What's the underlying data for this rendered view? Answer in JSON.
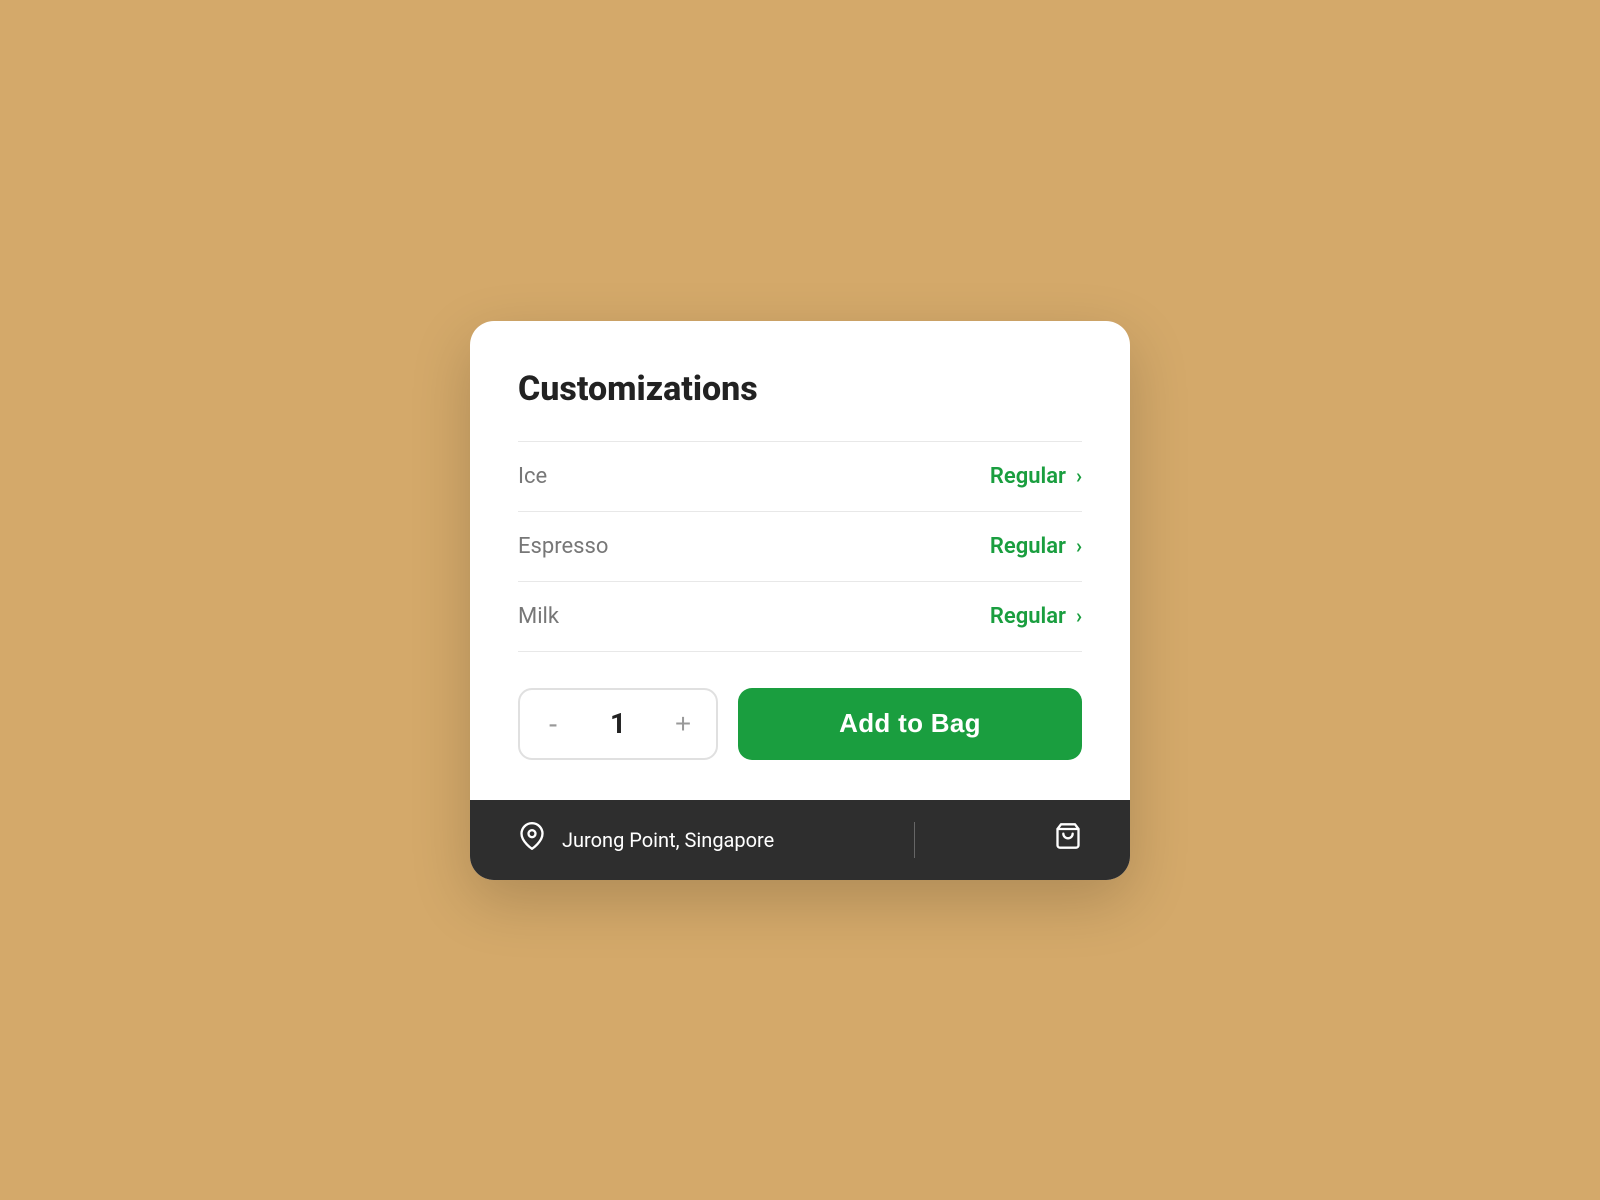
{
  "card": {
    "title": "Customizations",
    "customizations": [
      {
        "label": "Ice",
        "value": "Regular"
      },
      {
        "label": "Espresso",
        "value": "Regular"
      },
      {
        "label": "Milk",
        "value": "Regular"
      }
    ],
    "quantity": 1,
    "add_to_bag_label": "Add to Bag",
    "decrease_label": "-",
    "increase_label": "+"
  },
  "footer": {
    "location": "Jurong Point, Singapore",
    "location_icon": "pin-icon",
    "bag_icon": "shopping-bag-icon"
  },
  "colors": {
    "green": "#1a9e3f",
    "background": "#D4A96A",
    "card_bg": "#ffffff",
    "footer_bg": "#2e2e2e"
  }
}
